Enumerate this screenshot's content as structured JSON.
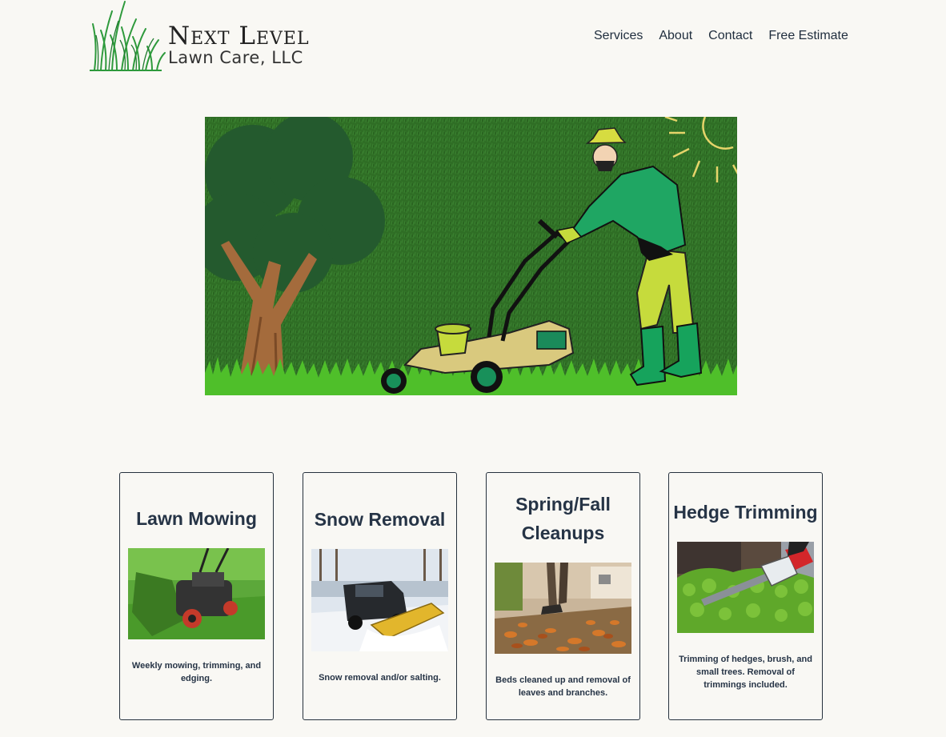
{
  "brand": {
    "name_line1": "Next Level",
    "name_line2": "Lawn Care, LLC"
  },
  "nav": {
    "items": [
      "Services",
      "About",
      "Contact",
      "Free Estimate"
    ]
  },
  "hero": {
    "illustration": "man-pushing-lawn-mower"
  },
  "services": [
    {
      "title": "Lawn Mowing",
      "description": "Weekly mowing, trimming, and edging.",
      "image": "lawn-mower-on-grass"
    },
    {
      "title": "Snow Removal",
      "description": "Snow removal and/or salting.",
      "image": "truck-with-snow-plow"
    },
    {
      "title": "Spring/Fall Cleanups",
      "description": "Beds cleaned up and removal of leaves and branches.",
      "image": "leaf-blower-on-path"
    },
    {
      "title": "Hedge Trimming",
      "description": "Trimming of hedges, brush, and small trees. Removal of trimmings included.",
      "image": "hedge-trimmer-on-bush"
    }
  ],
  "colors": {
    "background": "#f9f8f4",
    "text": "#1f2d3d",
    "grass": "#2b6b23",
    "card_border": "#26313d"
  }
}
